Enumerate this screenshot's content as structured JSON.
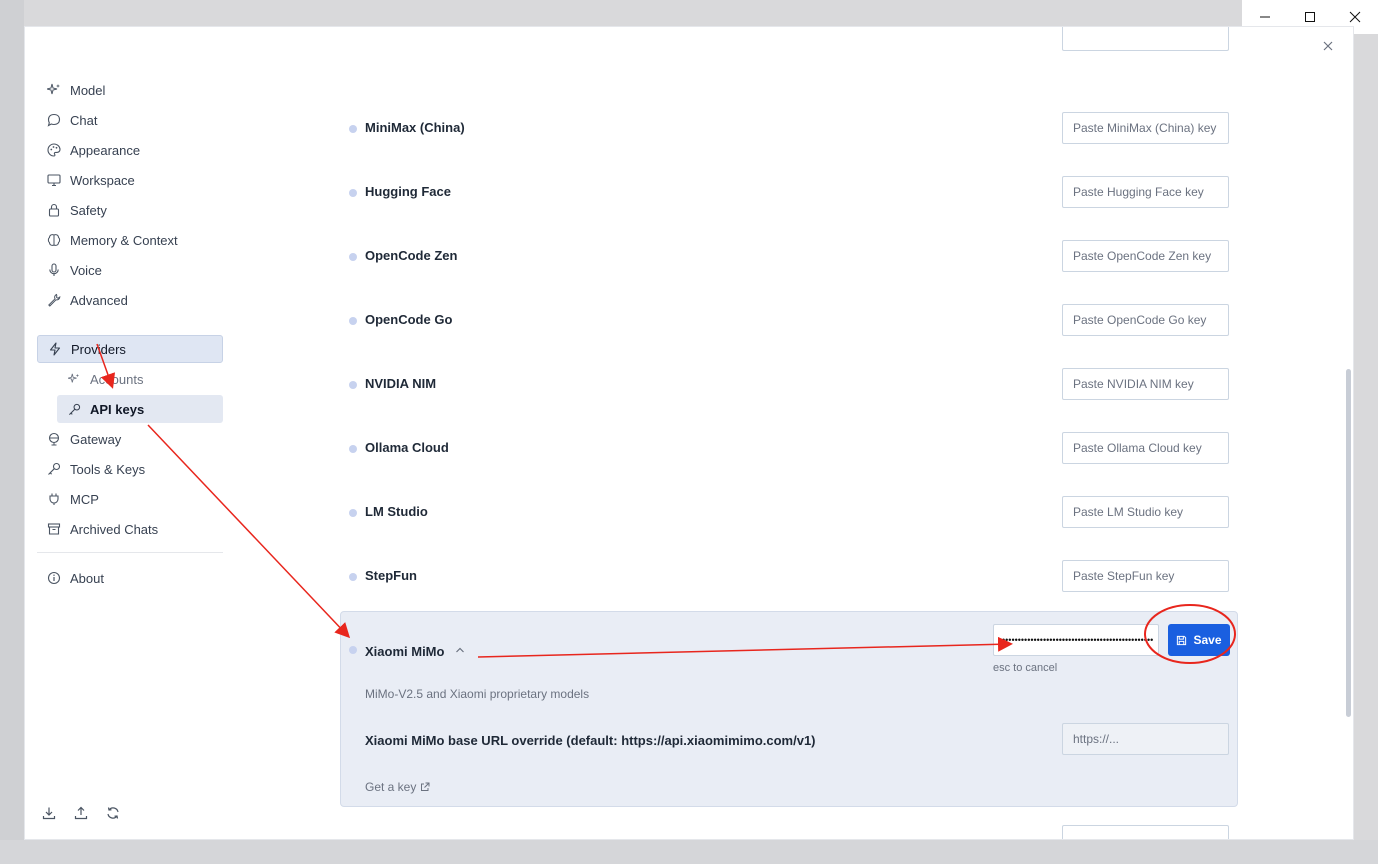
{
  "sidebar": {
    "items": [
      {
        "label": "Model",
        "icon": "sparkles-icon"
      },
      {
        "label": "Chat",
        "icon": "chat-bubble-icon"
      },
      {
        "label": "Appearance",
        "icon": "palette-icon"
      },
      {
        "label": "Workspace",
        "icon": "monitor-icon"
      },
      {
        "label": "Safety",
        "icon": "lock-icon"
      },
      {
        "label": "Memory & Context",
        "icon": "brain-icon"
      },
      {
        "label": "Voice",
        "icon": "microphone-icon"
      },
      {
        "label": "Advanced",
        "icon": "wrench-icon"
      },
      {
        "label": "Providers",
        "icon": "lightning-icon"
      },
      {
        "label": "Accounts",
        "icon": "sparkles-icon"
      },
      {
        "label": "API keys",
        "icon": "key-icon"
      },
      {
        "label": "Gateway",
        "icon": "globe-icon"
      },
      {
        "label": "Tools & Keys",
        "icon": "key-icon"
      },
      {
        "label": "MCP",
        "icon": "plug-icon"
      },
      {
        "label": "Archived Chats",
        "icon": "archive-icon"
      },
      {
        "label": "About",
        "icon": "info-icon"
      }
    ],
    "footer_icons": [
      "download-icon",
      "upload-icon",
      "refresh-icon"
    ]
  },
  "providers": [
    {
      "name": "MiniMax (China)",
      "placeholder": "Paste MiniMax (China) key"
    },
    {
      "name": "Hugging Face",
      "placeholder": "Paste Hugging Face key"
    },
    {
      "name": "OpenCode Zen",
      "placeholder": "Paste OpenCode Zen key"
    },
    {
      "name": "OpenCode Go",
      "placeholder": "Paste OpenCode Go key"
    },
    {
      "name": "NVIDIA NIM",
      "placeholder": "Paste NVIDIA NIM key"
    },
    {
      "name": "Ollama Cloud",
      "placeholder": "Paste Ollama Cloud key"
    },
    {
      "name": "LM Studio",
      "placeholder": "Paste LM Studio key"
    },
    {
      "name": "StepFun",
      "placeholder": "Paste StepFun key"
    }
  ],
  "expanded": {
    "name": "Xiaomi MiMo",
    "key_value": "••••••••••••••••••••••••••••••••••••••••••••••••",
    "hint": "esc to cancel",
    "save_label": "Save",
    "description": "MiMo-V2.5 and Xiaomi proprietary models",
    "base_url_label": "Xiaomi MiMo base URL override (default: https://api.xiaomimimo.com/v1)",
    "base_url_placeholder": "https://...",
    "get_key_label": "Get a key"
  },
  "colors": {
    "accent": "#1a5fe0",
    "annotation": "#e8261d",
    "active_bg": "#dfe6f3",
    "dot": "#c7d2ef"
  }
}
